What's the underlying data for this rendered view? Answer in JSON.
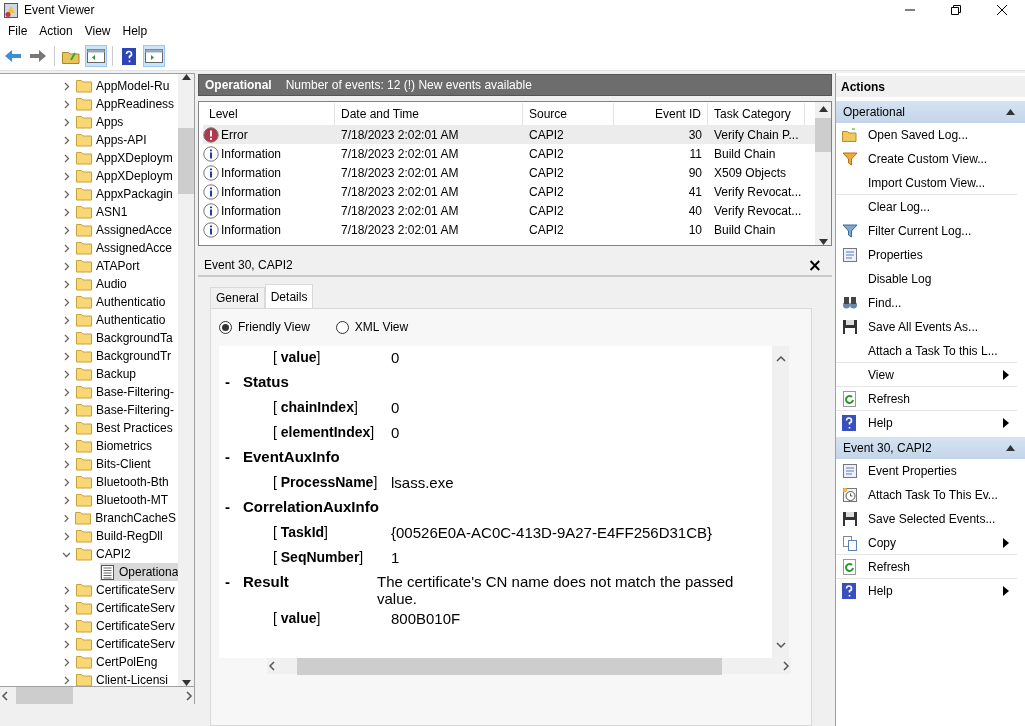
{
  "window": {
    "title": "Event Viewer"
  },
  "menu": [
    {
      "label": "File"
    },
    {
      "label": "Action"
    },
    {
      "label": "View"
    },
    {
      "label": "Help"
    }
  ],
  "toolbar": [
    {
      "kind": "back",
      "pressed": false
    },
    {
      "kind": "forward",
      "pressed": false
    },
    {
      "kind": "up",
      "pressed": false
    },
    {
      "kind": "tree",
      "pressed": true
    },
    {
      "kind": "help",
      "pressed": false
    },
    {
      "kind": "actions",
      "pressed": true
    }
  ],
  "tree": [
    {
      "label": "AppModel-Ru",
      "selected": false,
      "expanded": false
    },
    {
      "label": "AppReadiness",
      "selected": false,
      "expanded": false
    },
    {
      "label": "Apps",
      "selected": false,
      "expanded": false
    },
    {
      "label": "Apps-API",
      "selected": false,
      "expanded": false
    },
    {
      "label": "AppXDeploym",
      "selected": false,
      "expanded": false
    },
    {
      "label": "AppXDeploym",
      "selected": false,
      "expanded": false
    },
    {
      "label": "AppxPackagin",
      "selected": false,
      "expanded": false
    },
    {
      "label": "ASN1",
      "selected": false,
      "expanded": false
    },
    {
      "label": "AssignedAcce",
      "selected": false,
      "expanded": false
    },
    {
      "label": "AssignedAcce",
      "selected": false,
      "expanded": false
    },
    {
      "label": "ATAPort",
      "selected": false,
      "expanded": false
    },
    {
      "label": "Audio",
      "selected": false,
      "expanded": false
    },
    {
      "label": "Authenticatio",
      "selected": false,
      "expanded": false
    },
    {
      "label": "Authenticatio",
      "selected": false,
      "expanded": false
    },
    {
      "label": "BackgroundTa",
      "selected": false,
      "expanded": false
    },
    {
      "label": "BackgroundTr",
      "selected": false,
      "expanded": false
    },
    {
      "label": "Backup",
      "selected": false,
      "expanded": false
    },
    {
      "label": "Base-Filtering-",
      "selected": false,
      "expanded": false
    },
    {
      "label": "Base-Filtering-",
      "selected": false,
      "expanded": false
    },
    {
      "label": "Best Practices",
      "selected": false,
      "expanded": false
    },
    {
      "label": "Biometrics",
      "selected": false,
      "expanded": false
    },
    {
      "label": "Bits-Client",
      "selected": false,
      "expanded": false
    },
    {
      "label": "Bluetooth-Bth",
      "selected": false,
      "expanded": false
    },
    {
      "label": "Bluetooth-MT",
      "selected": false,
      "expanded": false
    },
    {
      "label": "BranchCacheS",
      "selected": false,
      "expanded": false
    },
    {
      "label": "Build-RegDll",
      "selected": false,
      "expanded": false
    },
    {
      "label": "CAPI2",
      "selected": false,
      "expanded": true,
      "children": [
        {
          "label": "Operationa",
          "selected": true
        }
      ]
    },
    {
      "label": "CertificateServ",
      "selected": false,
      "expanded": false
    },
    {
      "label": "CertificateServ",
      "selected": false,
      "expanded": false
    },
    {
      "label": "CertificateServ",
      "selected": false,
      "expanded": false
    },
    {
      "label": "CertificateServ",
      "selected": false,
      "expanded": false
    },
    {
      "label": "CertPolEng",
      "selected": false,
      "expanded": false
    },
    {
      "label": "Client-Licensi",
      "selected": false,
      "expanded": false
    }
  ],
  "log_header": {
    "title": "Operational",
    "summary": "Number of events: 12 (!) New events available"
  },
  "table": {
    "columns": [
      "Level",
      "Date and Time",
      "Source",
      "Event ID",
      "Task Category"
    ],
    "rows": [
      {
        "kind": "error",
        "level": "Error",
        "date": "7/18/2023 2:02:01 AM",
        "source": "CAPI2",
        "event_id": "30",
        "category": "Verify Chain P...",
        "selected": true
      },
      {
        "kind": "info",
        "level": "Information",
        "date": "7/18/2023 2:02:01 AM",
        "source": "CAPI2",
        "event_id": "11",
        "category": "Build Chain",
        "selected": false
      },
      {
        "kind": "info",
        "level": "Information",
        "date": "7/18/2023 2:02:01 AM",
        "source": "CAPI2",
        "event_id": "90",
        "category": "X509 Objects",
        "selected": false
      },
      {
        "kind": "info",
        "level": "Information",
        "date": "7/18/2023 2:02:01 AM",
        "source": "CAPI2",
        "event_id": "41",
        "category": "Verify Revocat...",
        "selected": false
      },
      {
        "kind": "info",
        "level": "Information",
        "date": "7/18/2023 2:02:01 AM",
        "source": "CAPI2",
        "event_id": "40",
        "category": "Verify Revocat...",
        "selected": false
      },
      {
        "kind": "info",
        "level": "Information",
        "date": "7/18/2023 2:02:01 AM",
        "source": "CAPI2",
        "event_id": "10",
        "category": "Build Chain",
        "selected": false
      }
    ]
  },
  "details": {
    "title": "Event 30, CAPI2",
    "close": "×",
    "tabs": [
      {
        "label": "General",
        "selected": false
      },
      {
        "label": "Details",
        "selected": true
      }
    ],
    "views": [
      {
        "label": "Friendly View",
        "selected": true
      },
      {
        "label": "XML View",
        "selected": false
      }
    ],
    "entries": [
      {
        "kind": "field",
        "label": "[ **value**]",
        "value": "0"
      },
      {
        "kind": "section",
        "marker": "-",
        "label": "Status"
      },
      {
        "kind": "field",
        "label": "[ **chainIndex**]",
        "value": "0"
      },
      {
        "kind": "field",
        "label": "[ **elementIndex**]",
        "value": "0"
      },
      {
        "kind": "section",
        "marker": "-",
        "label": "EventAuxInfo"
      },
      {
        "kind": "field",
        "label": "[ **ProcessName**]",
        "value": "lsass.exe"
      },
      {
        "kind": "section",
        "marker": "-",
        "label": "CorrelationAuxInfo"
      },
      {
        "kind": "field",
        "label": "[ **TaskId**]",
        "value": "{00526E0A-AC0C-413D-9A27-E4FF256D31CB}"
      },
      {
        "kind": "field",
        "label": "[ **SeqNumber**]",
        "value": "1"
      },
      {
        "kind": "section",
        "marker": "-",
        "label": "Result",
        "value": "The certificate's CN name does not match the passed value."
      },
      {
        "kind": "field",
        "label": "[ **value**]",
        "value": "800B010F"
      }
    ]
  },
  "actions": {
    "title": "Actions",
    "sections": [
      {
        "title": "Operational",
        "expanded": true,
        "items": [
          {
            "label": "Open Saved Log...",
            "kind": "folder",
            "submenu": false,
            "divider_below": false
          },
          {
            "label": "Create Custom View...",
            "kind": "funnel",
            "submenu": false,
            "divider_below": false
          },
          {
            "label": "Import Custom View...",
            "kind": "none",
            "submenu": false,
            "divider_below": true
          },
          {
            "label": "Clear Log...",
            "kind": "none",
            "submenu": false,
            "divider_below": false
          },
          {
            "label": "Filter Current Log...",
            "kind": "filter",
            "submenu": false,
            "divider_below": false
          },
          {
            "label": "Properties",
            "kind": "properties",
            "submenu": false,
            "divider_below": false
          },
          {
            "label": "Disable Log",
            "kind": "none",
            "submenu": false,
            "divider_below": false
          },
          {
            "label": "Find...",
            "kind": "binoculars",
            "submenu": false,
            "divider_below": false
          },
          {
            "label": "Save All Events As...",
            "kind": "disk",
            "submenu": false,
            "divider_below": false
          },
          {
            "label": "Attach a Task To this L...",
            "kind": "none",
            "submenu": false,
            "divider_below": true
          },
          {
            "label": "View",
            "kind": "none",
            "submenu": true,
            "divider_below": true
          },
          {
            "label": "Refresh",
            "kind": "refresh",
            "submenu": false,
            "divider_below": true
          },
          {
            "label": "Help",
            "kind": "help",
            "submenu": true,
            "divider_below": false
          }
        ]
      },
      {
        "title": "Event 30, CAPI2",
        "expanded": true,
        "items": [
          {
            "label": "Event Properties",
            "kind": "properties",
            "submenu": false,
            "divider_below": false
          },
          {
            "label": "Attach Task To This Ev...",
            "kind": "clock",
            "submenu": false,
            "divider_below": false
          },
          {
            "label": "Save Selected Events...",
            "kind": "disk",
            "submenu": false,
            "divider_below": false
          },
          {
            "label": "Copy",
            "kind": "copy",
            "submenu": true,
            "divider_below": true
          },
          {
            "label": "Refresh",
            "kind": "refresh",
            "submenu": false,
            "divider_below": true
          },
          {
            "label": "Help",
            "kind": "help",
            "submenu": true,
            "divider_below": false
          }
        ]
      }
    ]
  }
}
